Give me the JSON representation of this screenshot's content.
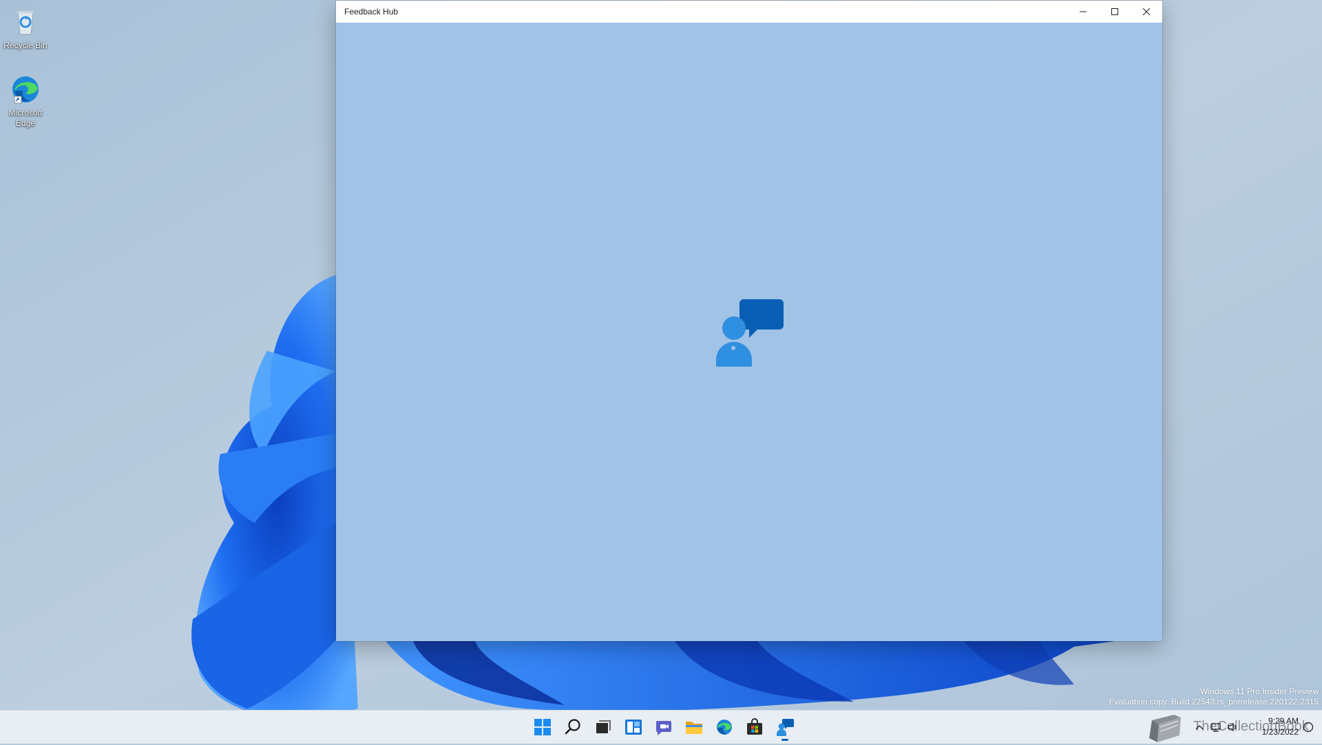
{
  "desktop": {
    "icons": [
      {
        "label": "Recycle Bin",
        "icon": "recycle-bin-icon"
      },
      {
        "label": "Microsoft Edge",
        "icon": "edge-icon"
      }
    ]
  },
  "window": {
    "title": "Feedback Hub",
    "background": "#a0c3e6",
    "splash_icon": "feedback-hub-icon",
    "caption": {
      "minimize": "minimize-icon",
      "maximize": "maximize-icon",
      "close": "close-icon"
    }
  },
  "watermark": {
    "line1": "Windows 11 Pro Insider Preview",
    "line2": "Evaluation copy. Build 22543.rs_prerelease.220122-2315"
  },
  "taskbar": {
    "apps": [
      {
        "name": "Start",
        "icon": "windows-start-icon"
      },
      {
        "name": "Search",
        "icon": "search-icon"
      },
      {
        "name": "Task View",
        "icon": "task-view-icon"
      },
      {
        "name": "Widgets",
        "icon": "widgets-icon"
      },
      {
        "name": "Chat",
        "icon": "chat-icon"
      },
      {
        "name": "File Explorer",
        "icon": "folder-icon"
      },
      {
        "name": "Microsoft Edge",
        "icon": "edge-icon"
      },
      {
        "name": "Microsoft Store",
        "icon": "store-icon"
      },
      {
        "name": "Feedback Hub",
        "icon": "feedback-hub-icon",
        "active": true
      }
    ],
    "tray": {
      "overlay_brand": "TheCollectionBook",
      "time": "9:29 AM",
      "date": "1/23/2022"
    }
  }
}
